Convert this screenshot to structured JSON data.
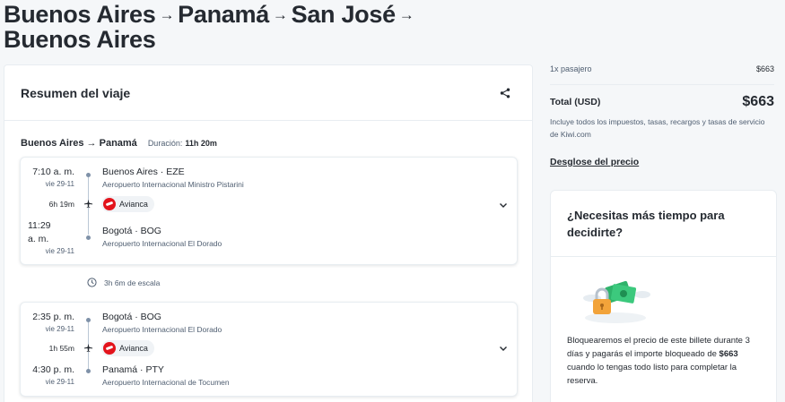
{
  "title": {
    "segments": [
      "Buenos Aires",
      "Panamá",
      "San José",
      "Buenos Aires"
    ],
    "arrow": "→"
  },
  "trip": {
    "header": "Resumen del viaje",
    "route": "Buenos Aires → Panamá",
    "duration_label": "Duración:",
    "duration_value": "11h 20m",
    "segment1": {
      "dep_time": "7:10 a. m.",
      "dep_date": "vie 29-11",
      "dep_place": "Buenos Aires · EZE",
      "dep_airport": "Aeropuerto Internacional Ministro Pistarini",
      "flight_duration": "6h 19m",
      "airline": "Avianca",
      "arr_time_line1": "11:29",
      "arr_time_line2": "a. m.",
      "arr_date": "vie 29-11",
      "arr_place": "Bogotá · BOG",
      "arr_airport": "Aeropuerto Internacional El Dorado"
    },
    "layover": "3h 6m de escala",
    "segment2": {
      "dep_time": "2:35 p. m.",
      "dep_date": "vie 29-11",
      "dep_place": "Bogotá · BOG",
      "dep_airport": "Aeropuerto Internacional El Dorado",
      "flight_duration": "1h 55m",
      "airline": "Avianca",
      "arr_time": "4:30 p. m.",
      "arr_date": "vie 29-11",
      "arr_place": "Panamá · PTY",
      "arr_airport": "Aeropuerto Internacional de Tocumen"
    }
  },
  "summary": {
    "passengers": "1x pasajero",
    "passengers_price": "$663",
    "total_label": "Total (USD)",
    "total_price": "$663",
    "taxes_note": "Incluye todos los impuestos, tasas, recargos y tasas de servicio de Kiwi.com",
    "breakdown_link": "Desglose del precio"
  },
  "decide": {
    "title": "¿Necesitas más tiempo para decidirte?",
    "text_pre": "Bloquearemos el precio de este billete durante 3 días y pagarás el importe bloqueado de ",
    "text_price": "$663",
    "text_post": " cuando lo tengas todo listo para completar la reserva."
  },
  "colors": {
    "ink": "#252a31",
    "muted": "#4f5e71",
    "avianca_red": "#e3141c",
    "illustration_green": "#2fb36b",
    "lock_orange": "#f2a33a"
  },
  "icons": [
    "share-icon",
    "chevron-down-icon",
    "plane-icon",
    "clock-icon",
    "lock-money-illustration"
  ]
}
